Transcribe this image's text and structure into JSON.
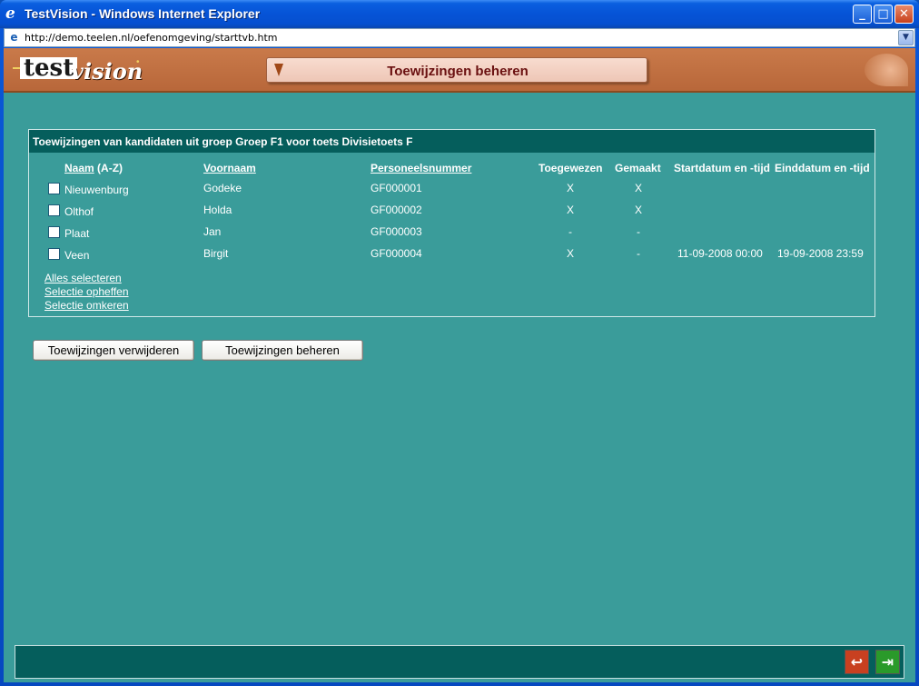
{
  "window": {
    "title": "TestVision - Windows Internet Explorer",
    "minimize": "_",
    "maximize": "□",
    "close": "✕"
  },
  "address": {
    "url": "http://demo.teelen.nl/oefenomgeving/starttvb.htm"
  },
  "app": {
    "logo_test": "test",
    "logo_vision": "vision",
    "page_title": "Toewijzingen beheren"
  },
  "panel": {
    "heading": "Toewijzingen van kandidaten uit groep Groep F1 voor toets Divisietoets F",
    "columns": {
      "naam": "Naam",
      "naam_sort": "(A-Z)",
      "voornaam": "Voornaam",
      "personeelsnummer": "Personeelsnummer",
      "toegewezen": "Toegewezen",
      "gemaakt": "Gemaakt",
      "start": "Startdatum en -tijd",
      "eind": "Einddatum en -tijd"
    },
    "rows": [
      {
        "naam": "Nieuwenburg",
        "voornaam": "Godeke",
        "nummer": "GF000001",
        "toegewezen": "X",
        "gemaakt": "X",
        "start": "",
        "eind": ""
      },
      {
        "naam": "Olthof",
        "voornaam": "Holda",
        "nummer": "GF000002",
        "toegewezen": "X",
        "gemaakt": "X",
        "start": "",
        "eind": ""
      },
      {
        "naam": "Plaat",
        "voornaam": "Jan",
        "nummer": "GF000003",
        "toegewezen": "-",
        "gemaakt": "-",
        "start": "",
        "eind": ""
      },
      {
        "naam": "Veen",
        "voornaam": "Birgit",
        "nummer": "GF000004",
        "toegewezen": "X",
        "gemaakt": "-",
        "start": "11-09-2008 00:00",
        "eind": "19-09-2008 23:59"
      }
    ],
    "select_all": "Alles selecteren",
    "clear_selection": "Selectie opheffen",
    "invert_selection": "Selectie omkeren"
  },
  "buttons": {
    "remove": "Toewijzingen verwijderen",
    "manage": "Toewijzingen beheren"
  },
  "colors": {
    "content_bg": "#3a9c9a",
    "panel_head": "#055e5c",
    "header_bg": "#c97a4a"
  }
}
